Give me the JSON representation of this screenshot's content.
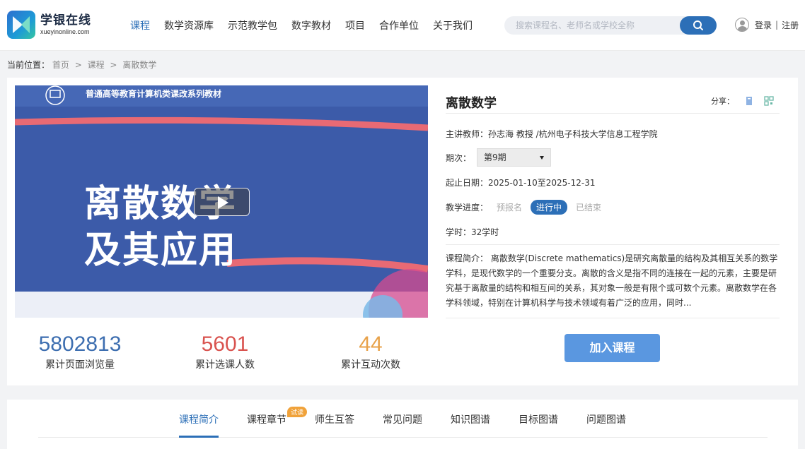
{
  "header": {
    "logo_cn": "学银在线",
    "logo_en": "xueyinonline.com",
    "nav": [
      {
        "label": "课程",
        "active": true
      },
      {
        "label": "数学资源库",
        "active": false
      },
      {
        "label": "示范教学包",
        "active": false
      },
      {
        "label": "数字教材",
        "active": false
      },
      {
        "label": "项目",
        "active": false
      },
      {
        "label": "合作单位",
        "active": false
      },
      {
        "label": "关于我们",
        "active": false
      }
    ],
    "search_placeholder": "搜索课程名、老师名或学校全称",
    "search_icon": "search-icon",
    "login": "登录",
    "separator": "|",
    "register": "注册",
    "accent_color": "#2c6fb7"
  },
  "breadcrumb": {
    "label": "当前位置：",
    "items": [
      "首页",
      "课程",
      "离散数学"
    ],
    "separator": ">"
  },
  "cover": {
    "banner": "普通高等教育计算机类课改系列教材",
    "title_line1": "离散数学",
    "title_line2": "及其应用",
    "play_icon": "play-icon"
  },
  "stats": [
    {
      "value": "5802813",
      "label": "累计页面浏览量",
      "color": "#3d6eb0"
    },
    {
      "value": "5601",
      "label": "累计选课人数",
      "color": "#d9534f"
    },
    {
      "value": "44",
      "label": "累计互动次数",
      "color": "#e8a24a"
    }
  ],
  "course": {
    "title": "离散数学",
    "share_label": "分享：",
    "teacher": "主讲教师：孙志海 教授 /杭州电子科技大学信息工程学院",
    "period_label": "期次：",
    "period_value": "第9期",
    "dates": "起止日期：2025-01-10至2025-12-31",
    "progress_label": "教学进度：",
    "progress": [
      {
        "label": "预报名",
        "active": false
      },
      {
        "label": "进行中",
        "active": true
      },
      {
        "label": "已结束",
        "active": false
      }
    ],
    "hours": "学时：32学时",
    "description": "课程简介： 离散数学(Discrete mathematics)是研究离散量的结构及其相互关系的数学学科，是现代数学的一个重要分支。离散的含义是指不同的连接在一起的元素，主要是研究基于离散量的结构和相互间的关系，其对象一般是有限个或可数个元素。离散数学在各学科领域，特别在计算机科学与技术领域有着广泛的应用，同时...",
    "join_button": "加入课程"
  },
  "tabs": [
    {
      "label": "课程简介",
      "active": true
    },
    {
      "label": "课程章节",
      "active": false
    },
    {
      "label": "师生互答",
      "active": false
    },
    {
      "label": "常见问题",
      "active": false
    },
    {
      "label": "知识图谱",
      "active": false
    },
    {
      "label": "目标图谱",
      "active": false
    },
    {
      "label": "问题图谱",
      "active": false
    }
  ],
  "trial_badge": "试读"
}
